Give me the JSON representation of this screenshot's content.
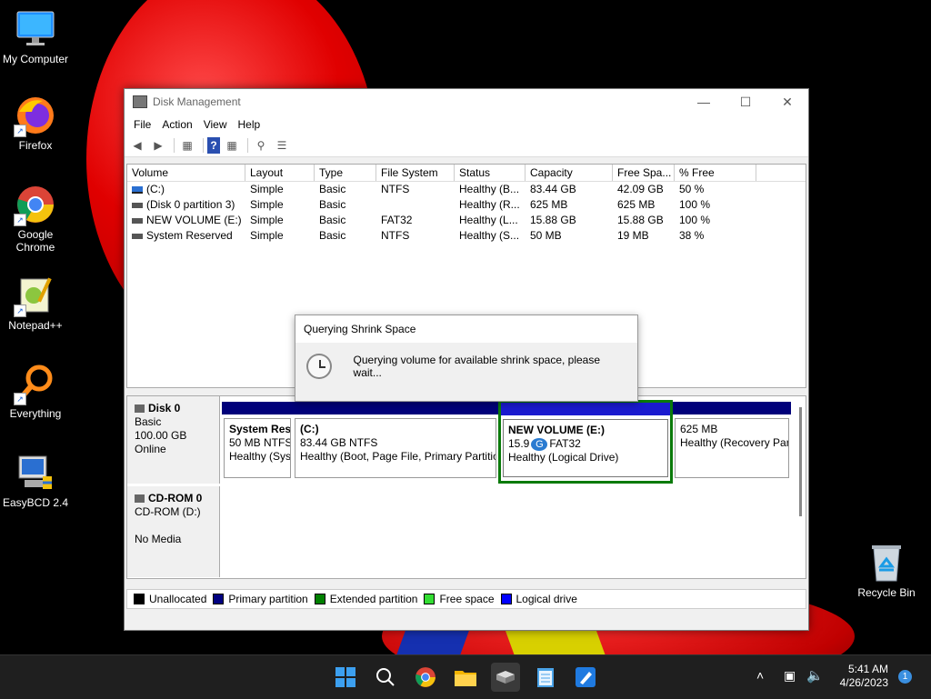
{
  "desktop": {
    "icons": [
      {
        "label": "My Computer"
      },
      {
        "label": "Firefox"
      },
      {
        "label": "Google Chrome"
      },
      {
        "label": "Notepad++"
      },
      {
        "label": "Everything"
      },
      {
        "label": "EasyBCD 2.4"
      },
      {
        "label": "Recycle Bin"
      }
    ]
  },
  "window": {
    "title": "Disk Management",
    "menu": [
      "File",
      "Action",
      "View",
      "Help"
    ],
    "columns": [
      "Volume",
      "Layout",
      "Type",
      "File System",
      "Status",
      "Capacity",
      "Free Spa...",
      "% Free"
    ],
    "volumes": [
      {
        "volume": "(C:)",
        "layout": "Simple",
        "type": "Basic",
        "fs": "NTFS",
        "status": "Healthy (B...",
        "capacity": "83.44 GB",
        "free": "42.09 GB",
        "pct": "50 %"
      },
      {
        "volume": "(Disk 0 partition 3)",
        "layout": "Simple",
        "type": "Basic",
        "fs": "",
        "status": "Healthy (R...",
        "capacity": "625 MB",
        "free": "625 MB",
        "pct": "100 %"
      },
      {
        "volume": "NEW VOLUME (E:)",
        "layout": "Simple",
        "type": "Basic",
        "fs": "FAT32",
        "status": "Healthy (L...",
        "capacity": "15.88 GB",
        "free": "15.88 GB",
        "pct": "100 %"
      },
      {
        "volume": "System Reserved",
        "layout": "Simple",
        "type": "Basic",
        "fs": "NTFS",
        "status": "Healthy (S...",
        "capacity": "50 MB",
        "free": "19 MB",
        "pct": "38 %"
      }
    ],
    "disks": {
      "disk0": {
        "name": "Disk 0",
        "type": "Basic",
        "size": "100.00 GB",
        "state": "Online"
      },
      "cdrom0": {
        "name": "CD-ROM 0",
        "type": "CD-ROM (D:)",
        "state": "No Media"
      }
    },
    "partitions": [
      {
        "name": "System Res",
        "detail": "50 MB NTFS",
        "status": "Healthy (Sys"
      },
      {
        "name": "(C:)",
        "detail": "83.44 GB NTFS",
        "status": "Healthy (Boot, Page File, Primary Partitio"
      },
      {
        "name": "NEW VOLUME  (E:)",
        "detail": "15.9",
        "detail_tail": "FAT32",
        "status": "Healthy (Logical Drive)"
      },
      {
        "name": "",
        "detail": "625 MB",
        "status": "Healthy (Recovery Par"
      }
    ],
    "legend": [
      "Unallocated",
      "Primary partition",
      "Extended partition",
      "Free space",
      "Logical drive"
    ],
    "legend_colors": [
      "#000000",
      "#000080",
      "#008000",
      "#33dd33",
      "#0000ff"
    ]
  },
  "dialog": {
    "title": "Querying Shrink Space",
    "message": "Querying volume for available shrink space, please wait..."
  },
  "taskbar": {
    "time": "5:41 AM",
    "date": "4/26/2023",
    "notifications": "1"
  }
}
